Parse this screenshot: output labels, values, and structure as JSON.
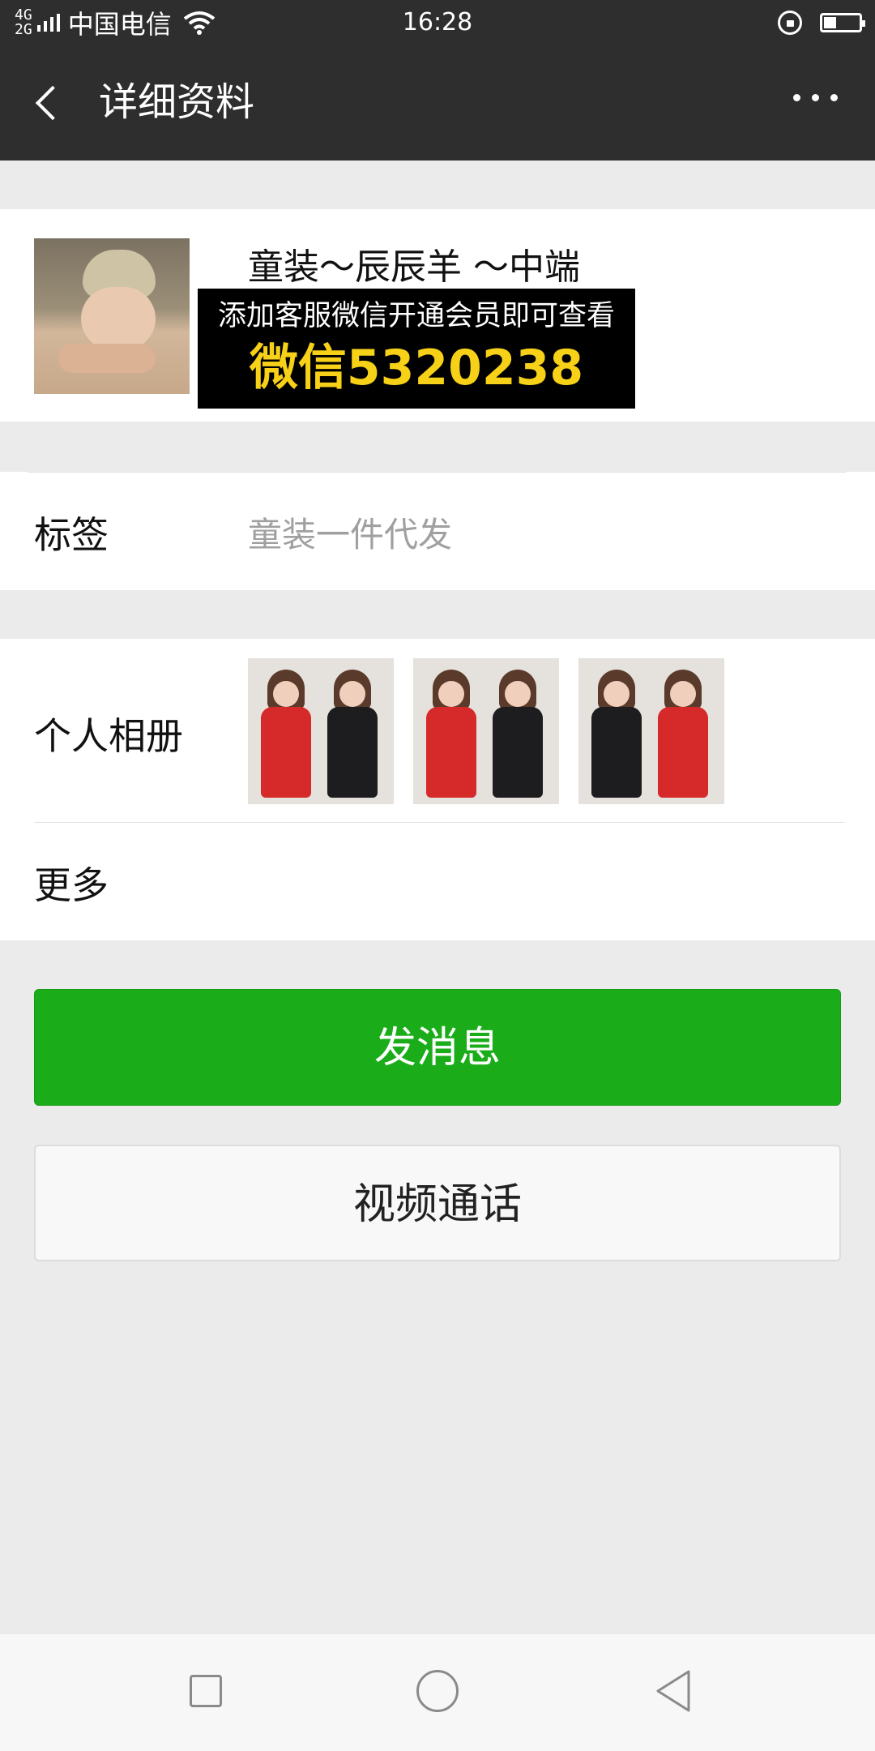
{
  "status_bar": {
    "network_top": "4G",
    "network_bottom": "2G",
    "carrier": "中国电信",
    "time": "16:28"
  },
  "header": {
    "title": "详细资料"
  },
  "profile": {
    "name": "童装～辰辰羊 ～中端",
    "promo_line1": "添加客服微信开通会员即可查看",
    "promo_line2": "微信5320238"
  },
  "tags": {
    "label": "标签",
    "value": "童装一件代发"
  },
  "album": {
    "label": "个人相册"
  },
  "more": {
    "label": "更多"
  },
  "buttons": {
    "send_message": "发消息",
    "video_call": "视频通话"
  },
  "colors": {
    "header_bg": "#2e2e2e",
    "primary_green": "#1aad19",
    "promo_yellow": "#f7d117"
  }
}
